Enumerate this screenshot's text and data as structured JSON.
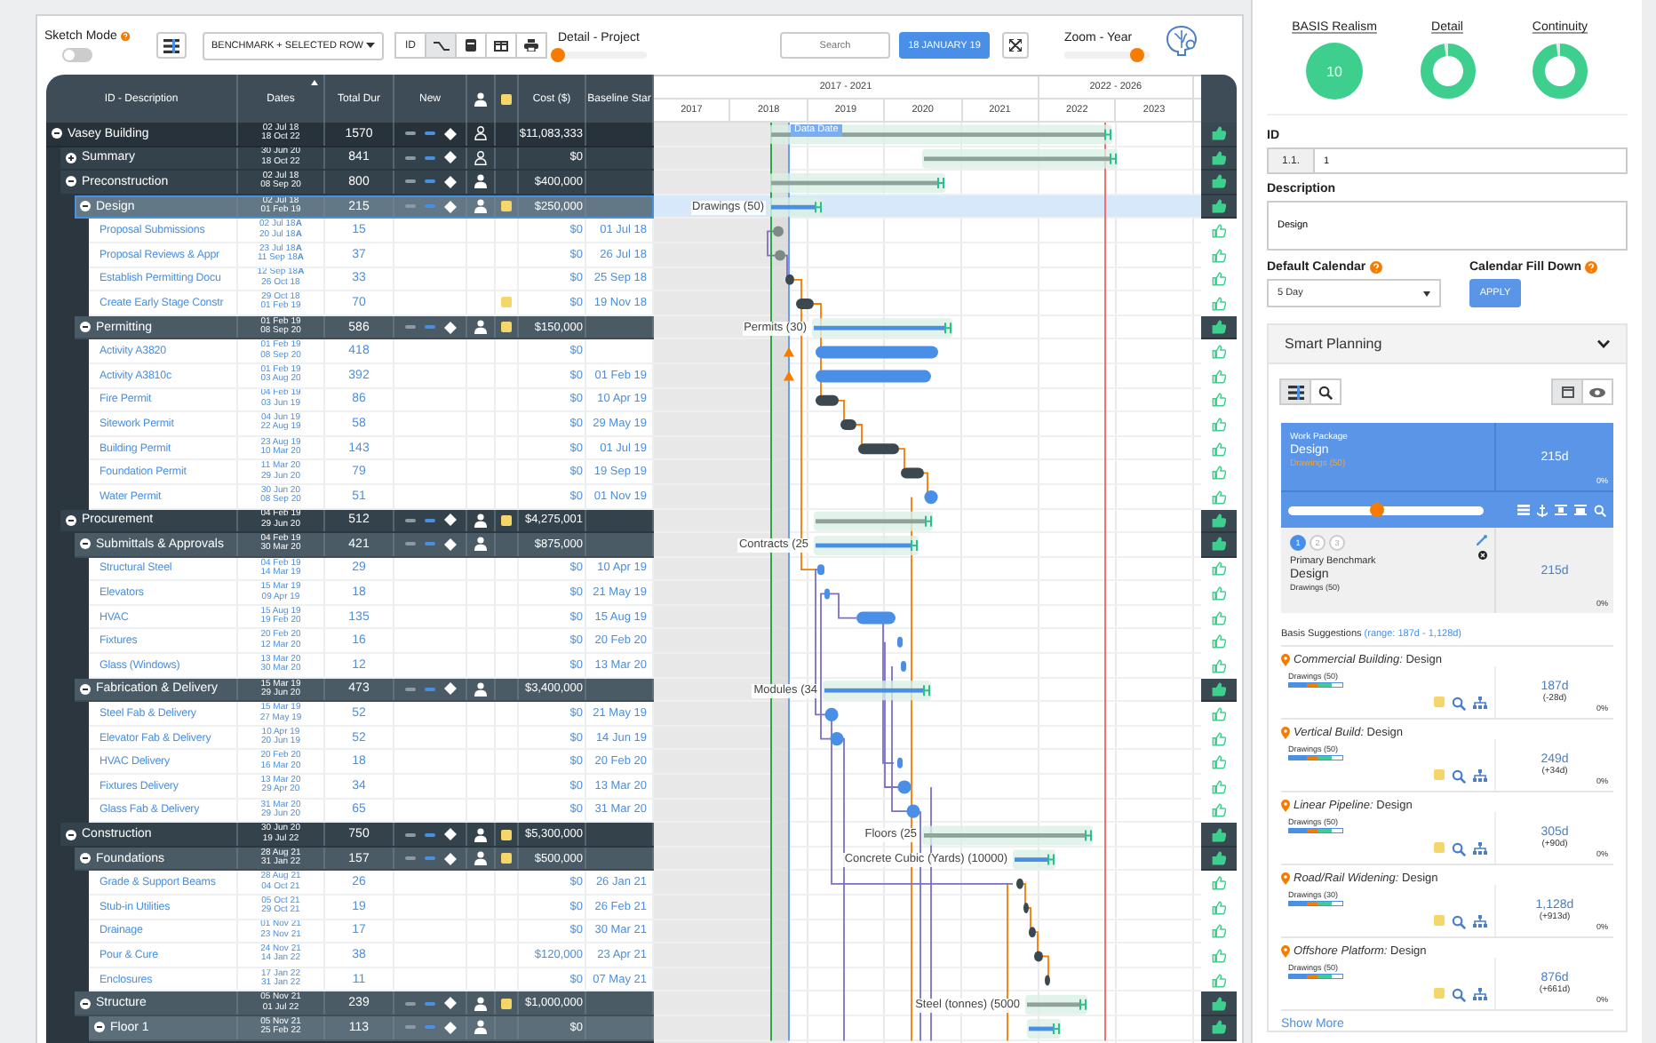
{
  "toolbar": {
    "sketch_mode": {
      "label": "Sketch Mode",
      "on": false
    },
    "view_dropdown": "BENCHMARK + SELECTED ROW",
    "view_buttons": [
      {
        "kind": "text",
        "label": "ID",
        "selected": false
      },
      {
        "kind": "link",
        "selected": true
      },
      {
        "kind": "card",
        "selected": false
      },
      {
        "kind": "columns",
        "selected": false
      },
      {
        "kind": "print",
        "selected": false
      }
    ],
    "detail_slider": {
      "label": "Detail - Project",
      "level": 0
    },
    "search": {
      "placeholder": "Search"
    },
    "date_button": "18 JANUARY 19",
    "zoom_slider": {
      "label": "Zoom - Year",
      "level": 0.85
    }
  },
  "table": {
    "columns": [
      {
        "kind": "text",
        "label": "ID - Description",
        "sorted": false
      },
      {
        "kind": "text",
        "label": "Dates",
        "sorted": true
      },
      {
        "kind": "text",
        "label": "Total Dur",
        "sorted": false
      },
      {
        "kind": "text",
        "label": "New",
        "sorted": false
      },
      {
        "kind": "person"
      },
      {
        "kind": "note"
      },
      {
        "kind": "text",
        "label": "Cost ($)",
        "sorted": false
      },
      {
        "kind": "text",
        "label": "Baseline Star",
        "sorted": false
      }
    ],
    "rows": [
      {
        "kind": "group",
        "name": "Vasey Building",
        "dates": [
          "02 Jul 18",
          "18 Oct 22"
        ],
        "total_dur": "1570",
        "cost": "$11,083,333",
        "assigned": false,
        "note": false,
        "expanded": true,
        "selected": false,
        "children": [
          {
            "kind": "group",
            "name": "Summary",
            "dates": [
              "30 Jun 20",
              "18 Oct 22"
            ],
            "total_dur": "841",
            "cost": "$0",
            "assigned": false,
            "note": false,
            "expanded": false,
            "selected": false
          },
          {
            "kind": "group",
            "name": "Preconstruction",
            "dates": [
              "02 Jul 18",
              "08 Sep 20"
            ],
            "total_dur": "800",
            "cost": "$400,000",
            "assigned": true,
            "note": false,
            "expanded": true,
            "selected": false,
            "children": [
              {
                "kind": "group",
                "name": "Design",
                "dates": [
                  "02 Jul 18",
                  "01 Feb 19"
                ],
                "total_dur": "215",
                "cost": "$250,000",
                "assigned": true,
                "note": true,
                "expanded": true,
                "selected": true,
                "bar_label": "Drawings (50)",
                "children": [
                  {
                    "kind": "task",
                    "name": "Proposal Submissions",
                    "dates": [
                      "02 Jul 18**A**",
                      "20 Jul 18**A**"
                    ],
                    "total_dur": "15",
                    "cost": "$0",
                    "baseline_start": "01 Jul 18",
                    "note": false,
                    "selected": false
                  },
                  {
                    "kind": "task",
                    "name": "Proposal Reviews & Appr",
                    "dates": [
                      "23 Jul 18**A**",
                      "11 Sep 18**A**"
                    ],
                    "total_dur": "37",
                    "cost": "$0",
                    "baseline_start": "26 Jul 18",
                    "note": false,
                    "selected": false
                  },
                  {
                    "kind": "task",
                    "name": "Establish Permitting Docu",
                    "dates": [
                      "12 Sep 18**A**",
                      "26 Oct 18"
                    ],
                    "total_dur": "33",
                    "cost": "$0",
                    "baseline_start": "25 Sep 18",
                    "note": false,
                    "selected": false
                  },
                  {
                    "kind": "task",
                    "name": "Create Early Stage Constr",
                    "dates": [
                      "29 Oct 18",
                      "01 Feb 19"
                    ],
                    "total_dur": "70",
                    "cost": "$0",
                    "baseline_start": "19 Nov 18",
                    "note": true,
                    "selected": false
                  }
                ]
              },
              {
                "kind": "group",
                "name": "Permitting",
                "dates": [
                  "01 Feb 19",
                  "08 Sep 20"
                ],
                "total_dur": "586",
                "cost": "$150,000",
                "assigned": true,
                "note": true,
                "expanded": true,
                "selected": false,
                "bar_label": "Permits (30)",
                "children": [
                  {
                    "kind": "task",
                    "name": "Activity A3820",
                    "dates": [
                      "01 Feb 19",
                      "08 Sep 20"
                    ],
                    "total_dur": "418",
                    "cost": "$0",
                    "note": false,
                    "selected": false
                  },
                  {
                    "kind": "task",
                    "name": "Activity A3810c",
                    "dates": [
                      "01 Feb 19",
                      "03 Aug 20"
                    ],
                    "total_dur": "392",
                    "cost": "$0",
                    "baseline_start": "01 Feb 19",
                    "note": false,
                    "selected": false
                  },
                  {
                    "kind": "task",
                    "name": "Fire Permit",
                    "dates": [
                      "04 Feb 19",
                      "03 Jun 19"
                    ],
                    "total_dur": "86",
                    "cost": "$0",
                    "baseline_start": "10 Apr 19",
                    "note": false,
                    "selected": false
                  },
                  {
                    "kind": "task",
                    "name": "Sitework Permit",
                    "dates": [
                      "04 Jun 19",
                      "22 Aug 19"
                    ],
                    "total_dur": "58",
                    "cost": "$0",
                    "baseline_start": "29 May 19",
                    "note": false,
                    "selected": false
                  },
                  {
                    "kind": "task",
                    "name": "Building Permit",
                    "dates": [
                      "23 Aug 19",
                      "10 Mar 20"
                    ],
                    "total_dur": "143",
                    "cost": "$0",
                    "baseline_start": "01 Jul 19",
                    "note": false,
                    "selected": false
                  },
                  {
                    "kind": "task",
                    "name": "Foundation Permit",
                    "dates": [
                      "11 Mar 20",
                      "29 Jun 20"
                    ],
                    "total_dur": "79",
                    "cost": "$0",
                    "baseline_start": "19 Sep 19",
                    "note": false,
                    "selected": false
                  },
                  {
                    "kind": "task",
                    "name": "Water Permit",
                    "dates": [
                      "30 Jun 20",
                      "08 Sep 20"
                    ],
                    "total_dur": "51",
                    "cost": "$0",
                    "baseline_start": "01 Nov 19",
                    "note": false,
                    "selected": false
                  }
                ]
              }
            ]
          },
          {
            "kind": "group",
            "name": "Procurement",
            "dates": [
              "04 Feb 19",
              "29 Jun 20"
            ],
            "total_dur": "512",
            "cost": "$4,275,001",
            "assigned": true,
            "note": true,
            "expanded": true,
            "selected": false,
            "children": [
              {
                "kind": "group",
                "name": "Submittals & Approvals",
                "dates": [
                  "04 Feb 19",
                  "30 Mar 20"
                ],
                "total_dur": "421",
                "cost": "$875,000",
                "assigned": true,
                "note": false,
                "expanded": true,
                "selected": false,
                "bar_label": "Contracts (25",
                "children": [
                  {
                    "kind": "task",
                    "name": "Structural Steel",
                    "dates": [
                      "04 Feb 19",
                      "14 Mar 19"
                    ],
                    "total_dur": "29",
                    "cost": "$0",
                    "baseline_start": "10 Apr 19",
                    "note": false,
                    "selected": false
                  },
                  {
                    "kind": "task",
                    "name": "Elevators",
                    "dates": [
                      "15 Mar 19",
                      "09 Apr 19"
                    ],
                    "total_dur": "18",
                    "cost": "$0",
                    "baseline_start": "21 May 19",
                    "note": false,
                    "selected": false
                  },
                  {
                    "kind": "task",
                    "name": "HVAC",
                    "dates": [
                      "15 Aug 19",
                      "19 Feb 20"
                    ],
                    "total_dur": "135",
                    "cost": "$0",
                    "baseline_start": "15 Aug 19",
                    "note": false,
                    "selected": false
                  },
                  {
                    "kind": "task",
                    "name": "Fixtures",
                    "dates": [
                      "20 Feb 20",
                      "12 Mar 20"
                    ],
                    "total_dur": "16",
                    "cost": "$0",
                    "baseline_start": "20 Feb 20",
                    "note": false,
                    "selected": false
                  },
                  {
                    "kind": "task",
                    "name": "Glass (Windows)",
                    "dates": [
                      "13 Mar 20",
                      "30 Mar 20"
                    ],
                    "total_dur": "12",
                    "cost": "$0",
                    "baseline_start": "13 Mar 20",
                    "note": false,
                    "selected": false
                  }
                ]
              },
              {
                "kind": "group",
                "name": "Fabrication & Delivery",
                "dates": [
                  "15 Mar 19",
                  "29 Jun 20"
                ],
                "total_dur": "473",
                "cost": "$3,400,000",
                "assigned": true,
                "note": false,
                "expanded": true,
                "selected": false,
                "bar_label": "Modules (34",
                "children": [
                  {
                    "kind": "task",
                    "name": "Steel Fab & Delivery",
                    "dates": [
                      "15 Mar 19",
                      "27 May 19"
                    ],
                    "total_dur": "52",
                    "cost": "$0",
                    "baseline_start": "21 May 19",
                    "note": false,
                    "selected": false
                  },
                  {
                    "kind": "task",
                    "name": "Elevator Fab & Delivery",
                    "dates": [
                      "10 Apr 19",
                      "20 Jun 19"
                    ],
                    "total_dur": "52",
                    "cost": "$0",
                    "baseline_start": "14 Jun 19",
                    "note": false,
                    "selected": false
                  },
                  {
                    "kind": "task",
                    "name": "HVAC Delivery",
                    "dates": [
                      "20 Feb 20",
                      "16 Mar 20"
                    ],
                    "total_dur": "18",
                    "cost": "$0",
                    "baseline_start": "20 Feb 20",
                    "note": false,
                    "selected": false
                  },
                  {
                    "kind": "task",
                    "name": "Fixtures Delivery",
                    "dates": [
                      "13 Mar 20",
                      "29 Apr 20"
                    ],
                    "total_dur": "34",
                    "cost": "$0",
                    "baseline_start": "13 Mar 20",
                    "note": false,
                    "selected": false
                  },
                  {
                    "kind": "task",
                    "name": "Glass Fab & Delivery",
                    "dates": [
                      "31 Mar 20",
                      "29 Jun 20"
                    ],
                    "total_dur": "65",
                    "cost": "$0",
                    "baseline_start": "31 Mar 20",
                    "note": false,
                    "selected": false
                  }
                ]
              }
            ]
          },
          {
            "kind": "group",
            "name": "Construction",
            "dates": [
              "30 Jun 20",
              "19 Jul 22"
            ],
            "total_dur": "750",
            "cost": "$5,300,000",
            "assigned": true,
            "note": true,
            "expanded": true,
            "selected": false,
            "bar_label": "Floors (25",
            "children": [
              {
                "kind": "group",
                "name": "Foundations",
                "dates": [
                  "28 Aug 21",
                  "31 Jan 22"
                ],
                "total_dur": "157",
                "cost": "$500,000",
                "assigned": true,
                "note": true,
                "expanded": true,
                "selected": false,
                "bar_label": "Concrete Cubic (Yards) (10000)",
                "children": [
                  {
                    "kind": "task",
                    "name": "Grade & Support Beams",
                    "dates": [
                      "28 Aug 21",
                      "04 Oct 21"
                    ],
                    "total_dur": "26",
                    "cost": "$0",
                    "baseline_start": "26 Jan 21",
                    "note": false,
                    "selected": false
                  },
                  {
                    "kind": "task",
                    "name": "Stub-in Utilities",
                    "dates": [
                      "05 Oct 21",
                      "29 Oct 21"
                    ],
                    "total_dur": "19",
                    "cost": "$0",
                    "baseline_start": "26 Feb 21",
                    "note": false,
                    "selected": false
                  },
                  {
                    "kind": "task",
                    "name": "Drainage",
                    "dates": [
                      "01 Nov 21",
                      "23 Nov 21"
                    ],
                    "total_dur": "17",
                    "cost": "$0",
                    "baseline_start": "30 Mar 21",
                    "note": false,
                    "selected": false
                  },
                  {
                    "kind": "task",
                    "name": "Pour & Cure",
                    "dates": [
                      "24 Nov 21",
                      "14 Jan 22"
                    ],
                    "total_dur": "38",
                    "cost": "$120,000",
                    "baseline_start": "23 Apr 21",
                    "note": false,
                    "selected": false
                  },
                  {
                    "kind": "task",
                    "name": "Enclosures",
                    "dates": [
                      "17 Jan 22",
                      "31 Jan 22"
                    ],
                    "total_dur": "11",
                    "cost": "$0",
                    "baseline_start": "07 May 21",
                    "note": false,
                    "selected": false
                  }
                ]
              },
              {
                "kind": "group",
                "name": "Structure",
                "dates": [
                  "05 Nov 21",
                  "01 Jul 22"
                ],
                "total_dur": "239",
                "cost": "$1,000,000",
                "assigned": true,
                "note": true,
                "expanded": true,
                "selected": false,
                "bar_label": "Steel (tonnes) (5000",
                "children": [
                  {
                    "kind": "group",
                    "name": "Floor 1",
                    "dates": [
                      "05 Nov 21",
                      "25 Feb 22"
                    ],
                    "total_dur": "113",
                    "cost": "$0",
                    "assigned": true,
                    "note": false,
                    "expanded": true,
                    "selected": false
                  }
                ]
              }
            ]
          }
        ]
      }
    ]
  },
  "gantt": {
    "periods": [
      {
        "label": "2017 - 2021",
        "years": [
          "2017",
          "2018",
          "2019",
          "2020",
          "2021"
        ]
      },
      {
        "label": "2022 - 2026",
        "years": [
          "2022",
          "2023"
        ]
      }
    ],
    "data_date_label": "Data Date"
  },
  "scores": [
    {
      "kind": "number",
      "label": "BASIS Realism",
      "value": "10"
    },
    {
      "kind": "donut",
      "label": "Detail",
      "level": 0.97
    },
    {
      "kind": "donut",
      "label": "Continuity",
      "level": 0.97
    }
  ],
  "form": {
    "id": {
      "label": "ID",
      "prefix": "1.1.",
      "value": "1"
    },
    "description": {
      "label": "Description",
      "value": "Design"
    },
    "calendar": {
      "label": "Default Calendar",
      "value": "5 Day"
    },
    "fill_down": {
      "label": "Calendar Fill Down",
      "button": "APPLY"
    }
  },
  "smart_planning": {
    "title": "Smart Planning",
    "expanded": true,
    "left_tools": [
      {
        "kind": "list",
        "selected": true
      },
      {
        "kind": "search",
        "selected": false
      }
    ],
    "right_tools": [
      {
        "kind": "calendar",
        "selected": true
      },
      {
        "kind": "eye",
        "selected": false
      }
    ],
    "work_package": {
      "label": "Work Package",
      "name": "Design",
      "detail": "Drawings (50)",
      "duration": "215d",
      "percent": "0%",
      "level": 0.45
    },
    "benchmark": {
      "steps": [
        {
          "label": "1",
          "selected": true
        },
        {
          "label": "2",
          "selected": false
        },
        {
          "label": "3",
          "selected": false
        }
      ],
      "label": "Primary Benchmark",
      "name": "Design",
      "detail": "Drawings (50)",
      "duration": "215d",
      "percent": "0%"
    },
    "suggestions_title": "Basis Suggestions",
    "suggestions_range": "(range: 187d - 1,128d)",
    "suggestions": [
      {
        "title": "*Commercial Building:* Design",
        "detail": "Drawings (50)",
        "duration": "187d",
        "delta": "(-28d)",
        "percent": "0%"
      },
      {
        "title": "*Vertical Build:* Design",
        "detail": "Drawings (50)",
        "duration": "249d",
        "delta": "(+34d)",
        "percent": "0%"
      },
      {
        "title": "*Linear Pipeline:* Design",
        "detail": "Drawings (50)",
        "duration": "305d",
        "delta": "(+90d)",
        "percent": "0%"
      },
      {
        "title": "*Road/Rail Widening:* Design",
        "detail": "Drawings (30)",
        "duration": "1,128d",
        "delta": "(+913d)",
        "percent": "0%"
      },
      {
        "title": "*Offshore Platform:* Design",
        "detail": "Drawings (50)",
        "duration": "876d",
        "delta": "(+661d)",
        "percent": "0%"
      }
    ],
    "show_more": "Show More"
  }
}
